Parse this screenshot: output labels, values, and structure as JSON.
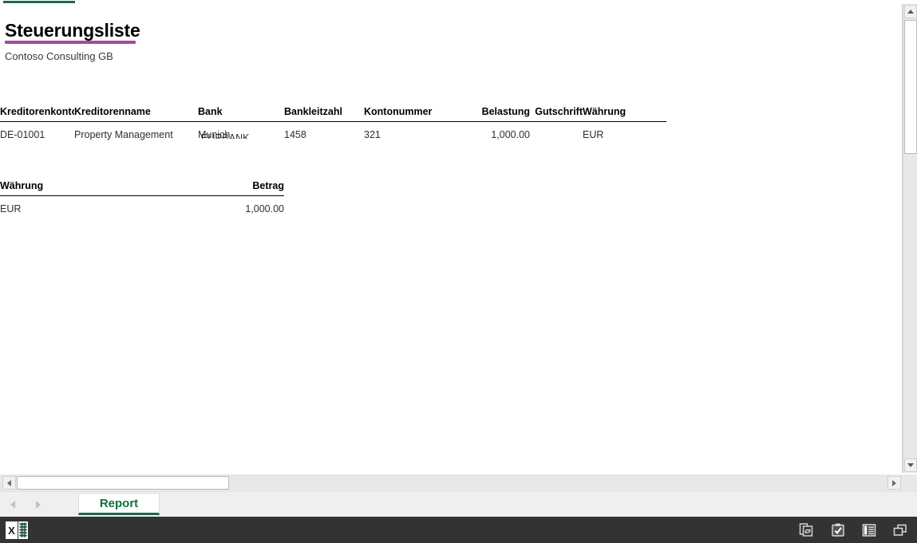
{
  "window": {
    "accent_green": "#1e6b46",
    "title_rule_color": "#a3499e"
  },
  "report": {
    "title": "Steuerungsliste",
    "subtitle": "Contoso Consulting GB",
    "overflow_text": "EURBANK"
  },
  "main_table": {
    "headers": [
      "Kreditorenkontonummer",
      "Kreditorenname",
      "Bank",
      "Bankleitzahl",
      "Kontonummer",
      "Belastung",
      "Gutschrift",
      "Währung"
    ],
    "rows": [
      {
        "kreditorenkontonummer": "DE-01001",
        "kreditorenname": "Property Management",
        "bank": "Munich",
        "bankleitzahl": "1458",
        "kontonummer": "321",
        "belastung": "1,000.00",
        "gutschrift": "",
        "waehrung": "EUR"
      }
    ]
  },
  "summary_table": {
    "headers": [
      "Währung",
      "Betrag"
    ],
    "rows": [
      {
        "waehrung": "EUR",
        "betrag": "1,000.00"
      }
    ]
  },
  "tabs": {
    "items": [
      {
        "label": "Report",
        "active": true
      }
    ],
    "prev_icon": "chevron-left-icon",
    "next_icon": "chevron-right-icon"
  },
  "scrollbars": {
    "vertical": {
      "up_icon": "scroll-up-arrow-icon",
      "down_icon": "scroll-down-arrow-icon"
    },
    "horizontal": {
      "left_icon": "scroll-left-arrow-icon",
      "right_icon": "scroll-right-arrow-icon"
    }
  },
  "taskbar": {
    "app_icon": "excel-app-icon",
    "app_letter": "X",
    "icons": [
      "sync-copy-icon",
      "clipboard-check-icon",
      "reading-list-icon",
      "restore-window-icon"
    ]
  }
}
